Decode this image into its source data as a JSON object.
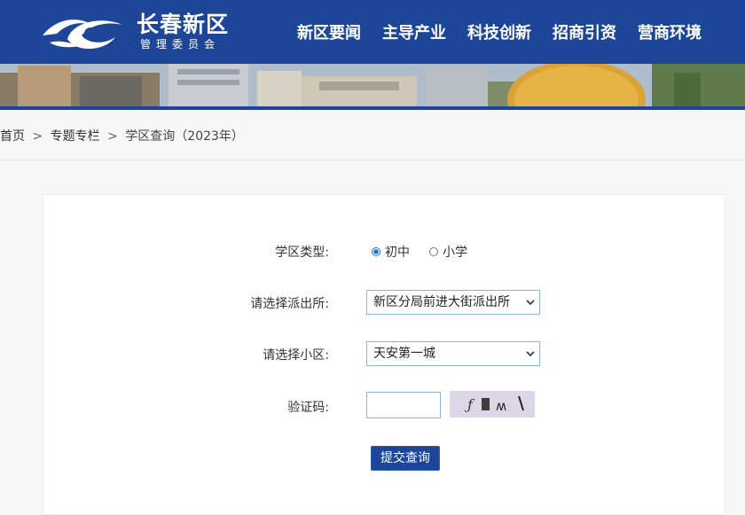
{
  "brand": {
    "title": "长春新区",
    "subtitle": "管理委员会"
  },
  "nav": [
    "新区要闻",
    "主导产业",
    "科技创新",
    "招商引资",
    "营商环境"
  ],
  "breadcrumb": {
    "home": "首页",
    "section": "专题专栏",
    "current": "学区查询（2023年）",
    "sep": ">"
  },
  "form": {
    "school_type_label": "学区类型:",
    "options": [
      {
        "label": "初中",
        "checked": true
      },
      {
        "label": "小学",
        "checked": false
      }
    ],
    "police_label": "请选择派出所:",
    "police_value": "新区分局前进大街派出所",
    "community_label": "请选择小区:",
    "community_value": "天安第一城",
    "captcha_label": "验证码:",
    "captcha_value": "",
    "captcha_text": "ƒ▮ʍ\\",
    "submit_label": "提交查询"
  },
  "colors": {
    "brand_blue": "#1d4698",
    "page_bg": "#f7f7f7"
  }
}
